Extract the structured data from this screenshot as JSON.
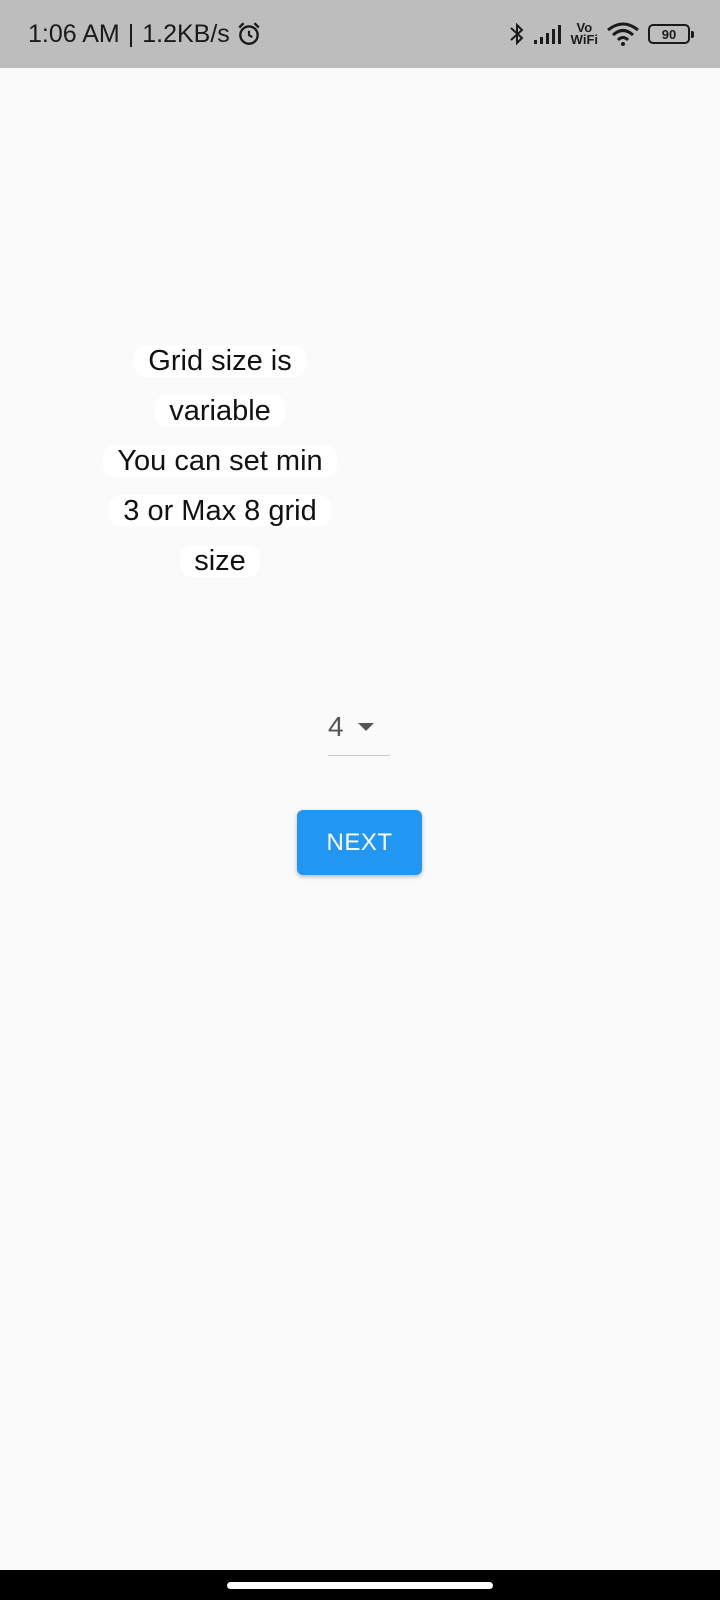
{
  "status_bar": {
    "time": "1:06 AM",
    "separator": "|",
    "network_speed": "1.2KB/s",
    "alarm_icon": "alarm-clock-icon",
    "bluetooth_icon": "bluetooth-icon",
    "signal_icon": "cell-signal-icon",
    "vowifi_top": "Vo",
    "vowifi_bottom": "WiFi",
    "wifi_icon": "wifi-icon",
    "battery_level": "90"
  },
  "info": {
    "lines": [
      "Grid size is",
      "variable",
      "You can set min",
      "3 or Max 8 grid",
      "size"
    ]
  },
  "grid_select": {
    "selected_value": "4"
  },
  "actions": {
    "next_label": "NEXT"
  },
  "colors": {
    "accent": "#2196f3",
    "background": "#fafafa",
    "status_bar": "#bdbdbd"
  }
}
